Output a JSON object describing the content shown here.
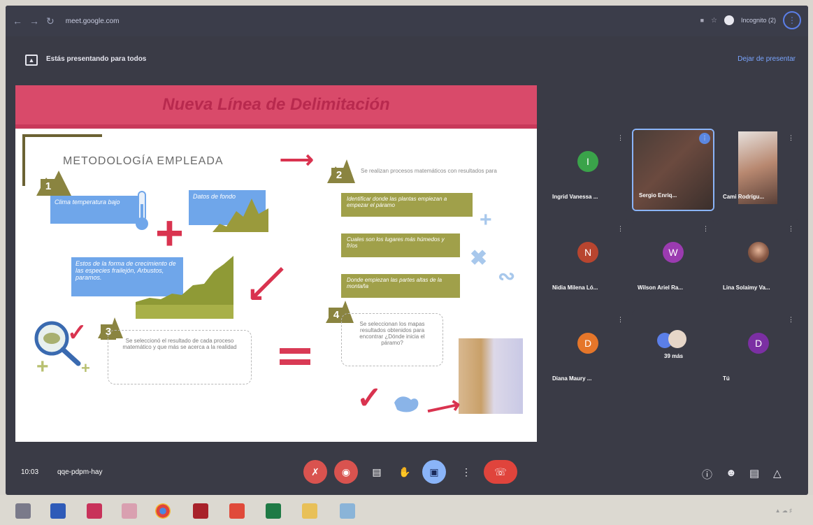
{
  "browser": {
    "url": "meet.google.com",
    "profile_label": "Incognito (2)"
  },
  "presenting": {
    "text": "Estás presentando para todos",
    "stop_label": "Dejar de presentar"
  },
  "slide": {
    "title": "Nueva Línea de Delimitación",
    "subtitle": "METODOLOGÍA EMPLEADA",
    "step1_box_a": "Clima temperatura bajo",
    "step1_box_b": "Datos de fondo",
    "step1_box_c": "Estos de la forma de crecimiento de las especies frailejón, Arbustos, paramos.",
    "step2_intro": "Se realizan procesos matemáticos con resultados para",
    "step2_band1": "Identificar donde las plantas empiezan a empezar el páramo",
    "step2_band2": "Cuales son los lugares más húmedos y fríos",
    "step2_band3": "Donde empiezan las partes altas de la montaña",
    "step3_text": "Se seleccionó el resultado de cada proceso matemático y que más se acerca a la realidad",
    "step4_text": "Se seleccionan los mapas resultados obtenidos para encontrar ¿Dónde inicia el páramo?",
    "numbers": [
      "1",
      "2",
      "3",
      "4"
    ]
  },
  "participants": [
    {
      "name": "Ingrid Vanessa ...",
      "initial": "I",
      "color": "#3aa34a"
    },
    {
      "name": "Sergio Enriq...",
      "initial": "",
      "color": "#5a3b33",
      "video": true,
      "speaking": true
    },
    {
      "name": "Cami Rodrígu...",
      "initial": "",
      "color": "#6a5a55",
      "video": true
    },
    {
      "name": "Nidia Milena Ló...",
      "initial": "N",
      "color": "#b8452f"
    },
    {
      "name": "Wilson Ariel Ra...",
      "initial": "W",
      "color": "#9b3bb0"
    },
    {
      "name": "Lina Solaimy Va...",
      "initial": "",
      "color": "#7a4a3a",
      "photo": true
    },
    {
      "name": "Diana Maury ...",
      "initial": "D",
      "color": "#e5762a"
    },
    {
      "name": "39 más",
      "initial": "",
      "color": "#4a5a8a"
    },
    {
      "name": "Tú",
      "initial": "D",
      "color": "#7b2fa3"
    }
  ],
  "meeting": {
    "time": "10:03",
    "code": "qqe-pdpm-hay"
  }
}
